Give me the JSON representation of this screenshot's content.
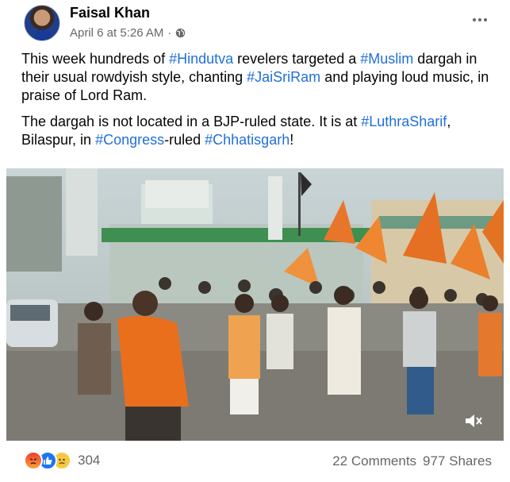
{
  "post": {
    "author": "Faisal Khan",
    "timestamp": "April 6 at 5:26 AM",
    "separator": "·",
    "privacy_icon": "globe-icon",
    "more_icon": "more-options-icon",
    "paragraph1": {
      "t1": "This week hundreds of ",
      "h1": "#Hindutva",
      "t2": " revelers targeted a ",
      "h2": "#Muslim",
      "t3": " dargah in their usual rowdyish style, chanting ",
      "h3": "#JaiSriRam",
      "t4": " and playing loud music, in praise of Lord Ram."
    },
    "paragraph2": {
      "t1": "The dargah is not located in a BJP-ruled state. It is at ",
      "h1": "#LuthraSharif",
      "t2": ", Bilaspur, in ",
      "h2": "#Congress",
      "t3": "-ruled ",
      "h3": "#Chhatisgarh",
      "t4": "!"
    },
    "media": {
      "type": "video",
      "mute_icon": "speaker-muted-icon"
    },
    "footer": {
      "reaction_icons": [
        "angry-react-icon",
        "like-react-icon",
        "sad-react-icon"
      ],
      "reaction_count": "304",
      "comments": "22 Comments",
      "shares": "977 Shares"
    }
  },
  "colors": {
    "hashtag": "#216fdb",
    "secondary_text": "#65676b",
    "like_blue": "#1877f2"
  }
}
